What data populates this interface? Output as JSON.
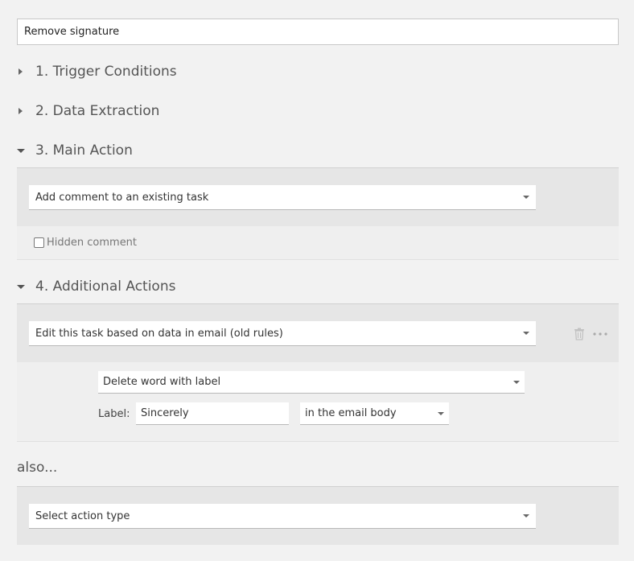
{
  "rule_name": "Remove signature",
  "sections": {
    "trigger": "1. Trigger Conditions",
    "extraction": "2. Data Extraction",
    "main": "3. Main Action",
    "additional": "4. Additional Actions"
  },
  "main_action": {
    "selected": "Add comment to an existing task",
    "hidden_comment_label": "Hidden comment",
    "hidden_comment_checked": false
  },
  "additional_action": {
    "selected": "Edit this task based on data in email (old rules)",
    "sub_action": "Delete word with label",
    "label_caption": "Label:",
    "label_value": "Sincerely",
    "location": "in the email body"
  },
  "also": {
    "heading": "also...",
    "placeholder": "Select action type"
  },
  "icons": {
    "delete": "trash-icon",
    "more": "more-horizontal-icon"
  }
}
